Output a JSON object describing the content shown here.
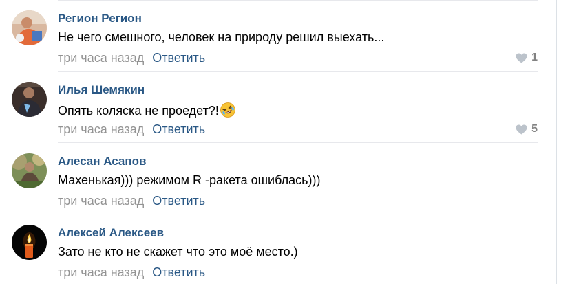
{
  "comments": [
    {
      "author": "Регион Регион",
      "text": "Не чего смешного, человек на природу решил выехать...",
      "time": "три часа назад",
      "reply_label": "Ответить",
      "likes": "1",
      "avatar_icon": "user-photo-avatar"
    },
    {
      "author": "Илья Шемякин",
      "text": "Опять коляска не проедет?!",
      "emoji": "rolling-on-floor-laughing-emoji",
      "time": "три часа назад",
      "reply_label": "Ответить",
      "likes": "5",
      "avatar_icon": "user-photo-avatar"
    },
    {
      "author": "Алесан Асапов",
      "text": "Махенькая))) режимом R -ракета ошиблась)))",
      "time": "три часа назад",
      "reply_label": "Ответить",
      "avatar_icon": "user-photo-avatar"
    },
    {
      "author": "Алексей Алексеев",
      "text": "Зато не кто не скажет что это моё место.)",
      "time": "три часа назад",
      "reply_label": "Ответить",
      "avatar_icon": "candle-avatar"
    }
  ],
  "colors": {
    "author": "#2a5885",
    "reply": "#2a5885",
    "time": "#939393",
    "likes": "#828282",
    "divider": "#e7e8ec"
  }
}
